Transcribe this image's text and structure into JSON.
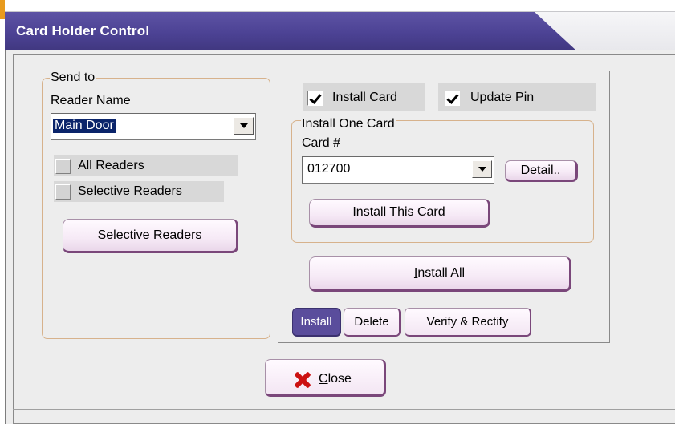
{
  "window": {
    "title": "Card Holder Control"
  },
  "send_to": {
    "caption": "Send to",
    "reader_name_label": "Reader Name",
    "reader_combo_value": "Main Door",
    "all_readers_label": "All Readers",
    "selective_readers_check_label": "Selective Readers",
    "selective_readers_button_label": "Selective Readers"
  },
  "options": {
    "install_card_label": "Install Card",
    "install_card_checked": true,
    "update_pin_label": "Update Pin",
    "update_pin_checked": true
  },
  "install_one": {
    "caption": "Install One Card",
    "card_number_label": "Card #",
    "card_combo_value": "012700",
    "detail_button_label": "Detail..",
    "install_this_card_label": "Install This Card"
  },
  "install_all_label": "Install All",
  "tabs": [
    {
      "label": "Install",
      "active": true
    },
    {
      "label": "Delete",
      "active": false
    },
    {
      "label": "Verify & Rectify",
      "active": false
    }
  ],
  "close_label": "Close",
  "colors": {
    "title_bar": "#4c4294",
    "title_accent": "#e89b1e",
    "active_tab": "#5a4d9c",
    "close_icon": "#cc1111",
    "button_border": "#7a477a"
  },
  "icons": {
    "close": "red-x-icon"
  }
}
